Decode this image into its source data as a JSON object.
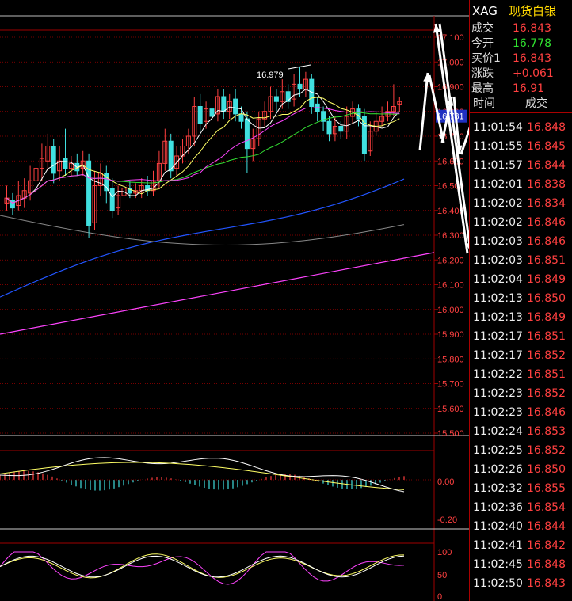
{
  "quote": {
    "symbol": "XAG",
    "name": "现货白银",
    "fields": [
      {
        "label": "成交",
        "value": "16.843",
        "color": "#ff4040"
      },
      {
        "label": "今开",
        "value": "16.778",
        "color": "#30e030"
      },
      {
        "label": "买价1",
        "value": "16.843",
        "color": "#ff4040"
      },
      {
        "label": "涨跌",
        "value": "+0.061",
        "color": "#ff4040"
      },
      {
        "label": "最高",
        "value": "16.91",
        "color": "#ff4040"
      }
    ]
  },
  "trades_header": {
    "time": "时间",
    "price": "成交"
  },
  "trades": [
    {
      "time": "11:01:54",
      "price": "16.848"
    },
    {
      "time": "11:01:55",
      "price": "16.845"
    },
    {
      "time": "11:01:57",
      "price": "16.844"
    },
    {
      "time": "11:02:01",
      "price": "16.838"
    },
    {
      "time": "11:02:02",
      "price": "16.834"
    },
    {
      "time": "11:02:02",
      "price": "16.846"
    },
    {
      "time": "11:02:03",
      "price": "16.846"
    },
    {
      "time": "11:02:03",
      "price": "16.851"
    },
    {
      "time": "11:02:04",
      "price": "16.849"
    },
    {
      "time": "11:02:13",
      "price": "16.850"
    },
    {
      "time": "11:02:13",
      "price": "16.849"
    },
    {
      "time": "11:02:17",
      "price": "16.851"
    },
    {
      "time": "11:02:17",
      "price": "16.852"
    },
    {
      "time": "11:02:22",
      "price": "16.851"
    },
    {
      "time": "11:02:23",
      "price": "16.852"
    },
    {
      "time": "11:02:23",
      "price": "16.846"
    },
    {
      "time": "11:02:24",
      "price": "16.853"
    },
    {
      "time": "11:02:25",
      "price": "16.852"
    },
    {
      "time": "11:02:26",
      "price": "16.850"
    },
    {
      "time": "11:02:32",
      "price": "16.855"
    },
    {
      "time": "11:02:36",
      "price": "16.854"
    },
    {
      "time": "11:02:40",
      "price": "16.844"
    },
    {
      "time": "11:02:41",
      "price": "16.842"
    },
    {
      "time": "11:02:45",
      "price": "16.848"
    },
    {
      "time": "11:02:50",
      "price": "16.843"
    }
  ],
  "price_axis": {
    "ticks": [
      "17.100",
      "17.000",
      "16.900",
      "16.800",
      "16.700",
      "16.600",
      "16.500",
      "16.400",
      "16.300",
      "16.200",
      "16.100",
      "16.000",
      "15.900",
      "15.800",
      "15.700",
      "15.600",
      "15.500"
    ],
    "current_price_tag": "16.781",
    "high_annotation": "16.979"
  },
  "macd_axis": {
    "ticks": [
      "0.00",
      "-0.20"
    ]
  },
  "kdj_axis": {
    "ticks": [
      "100",
      "50",
      "0"
    ]
  },
  "colors": {
    "up": "#ff4040",
    "down": "#40e0e0",
    "grid": "#a00000",
    "ma5": "#ffffff",
    "ma10": "#ffff66",
    "ma20": "#ff44ff",
    "ma30": "#33dd33",
    "ma60": "#2255ff",
    "ma120": "#888888",
    "ma250": "#ff44ff"
  },
  "chart_data": {
    "type": "candlestick",
    "ylim": [
      15.5,
      17.1
    ],
    "candles": [
      {
        "o": 16.43,
        "c": 16.45,
        "h": 16.5,
        "l": 16.4
      },
      {
        "o": 16.44,
        "c": 16.41,
        "h": 16.47,
        "l": 16.38
      },
      {
        "o": 16.42,
        "c": 16.46,
        "h": 16.52,
        "l": 16.4
      },
      {
        "o": 16.45,
        "c": 16.48,
        "h": 16.53,
        "l": 16.41
      },
      {
        "o": 16.47,
        "c": 16.52,
        "h": 16.58,
        "l": 16.44
      },
      {
        "o": 16.52,
        "c": 16.57,
        "h": 16.62,
        "l": 16.49
      },
      {
        "o": 16.57,
        "c": 16.61,
        "h": 16.67,
        "l": 16.52
      },
      {
        "o": 16.6,
        "c": 16.66,
        "h": 16.71,
        "l": 16.56
      },
      {
        "o": 16.66,
        "c": 16.55,
        "h": 16.69,
        "l": 16.51
      },
      {
        "o": 16.56,
        "c": 16.6,
        "h": 16.66,
        "l": 16.52
      },
      {
        "o": 16.61,
        "c": 16.57,
        "h": 16.73,
        "l": 16.54
      },
      {
        "o": 16.57,
        "c": 16.59,
        "h": 16.62,
        "l": 16.54
      },
      {
        "o": 16.59,
        "c": 16.56,
        "h": 16.63,
        "l": 16.54
      },
      {
        "o": 16.57,
        "c": 16.6,
        "h": 16.64,
        "l": 16.54
      },
      {
        "o": 16.6,
        "c": 16.34,
        "h": 16.63,
        "l": 16.29
      },
      {
        "o": 16.35,
        "c": 16.5,
        "h": 16.56,
        "l": 16.32
      },
      {
        "o": 16.5,
        "c": 16.55,
        "h": 16.59,
        "l": 16.46
      },
      {
        "o": 16.55,
        "c": 16.48,
        "h": 16.58,
        "l": 16.43
      },
      {
        "o": 16.49,
        "c": 16.4,
        "h": 16.53,
        "l": 16.37
      },
      {
        "o": 16.41,
        "c": 16.46,
        "h": 16.5,
        "l": 16.38
      },
      {
        "o": 16.46,
        "c": 16.49,
        "h": 16.53,
        "l": 16.43
      },
      {
        "o": 16.49,
        "c": 16.47,
        "h": 16.52,
        "l": 16.45
      },
      {
        "o": 16.47,
        "c": 16.48,
        "h": 16.51,
        "l": 16.45
      },
      {
        "o": 16.48,
        "c": 16.5,
        "h": 16.53,
        "l": 16.45
      },
      {
        "o": 16.5,
        "c": 16.48,
        "h": 16.54,
        "l": 16.46
      },
      {
        "o": 16.48,
        "c": 16.52,
        "h": 16.56,
        "l": 16.46
      },
      {
        "o": 16.52,
        "c": 16.59,
        "h": 16.64,
        "l": 16.49
      },
      {
        "o": 16.59,
        "c": 16.68,
        "h": 16.73,
        "l": 16.56
      },
      {
        "o": 16.68,
        "c": 16.56,
        "h": 16.71,
        "l": 16.53
      },
      {
        "o": 16.57,
        "c": 16.62,
        "h": 16.66,
        "l": 16.54
      },
      {
        "o": 16.62,
        "c": 16.66,
        "h": 16.69,
        "l": 16.59
      },
      {
        "o": 16.66,
        "c": 16.7,
        "h": 16.73,
        "l": 16.63
      },
      {
        "o": 16.7,
        "c": 16.82,
        "h": 16.86,
        "l": 16.66
      },
      {
        "o": 16.82,
        "c": 16.75,
        "h": 16.87,
        "l": 16.72
      },
      {
        "o": 16.76,
        "c": 16.81,
        "h": 16.84,
        "l": 16.73
      },
      {
        "o": 16.81,
        "c": 16.78,
        "h": 16.84,
        "l": 16.75
      },
      {
        "o": 16.79,
        "c": 16.86,
        "h": 16.89,
        "l": 16.76
      },
      {
        "o": 16.86,
        "c": 16.8,
        "h": 16.89,
        "l": 16.77
      },
      {
        "o": 16.8,
        "c": 16.84,
        "h": 16.87,
        "l": 16.77
      },
      {
        "o": 16.85,
        "c": 16.79,
        "h": 16.89,
        "l": 16.76
      },
      {
        "o": 16.79,
        "c": 16.76,
        "h": 16.82,
        "l": 16.73
      },
      {
        "o": 16.77,
        "c": 16.65,
        "h": 16.8,
        "l": 16.55
      },
      {
        "o": 16.65,
        "c": 16.69,
        "h": 16.73,
        "l": 16.6
      },
      {
        "o": 16.69,
        "c": 16.77,
        "h": 16.8,
        "l": 16.66
      },
      {
        "o": 16.77,
        "c": 16.8,
        "h": 16.84,
        "l": 16.74
      },
      {
        "o": 16.8,
        "c": 16.86,
        "h": 16.9,
        "l": 16.77
      },
      {
        "o": 16.86,
        "c": 16.84,
        "h": 16.89,
        "l": 16.8
      },
      {
        "o": 16.84,
        "c": 16.88,
        "h": 16.93,
        "l": 16.81
      },
      {
        "o": 16.88,
        "c": 16.84,
        "h": 16.91,
        "l": 16.81
      },
      {
        "o": 16.85,
        "c": 16.91,
        "h": 16.95,
        "l": 16.82
      },
      {
        "o": 16.91,
        "c": 16.89,
        "h": 16.98,
        "l": 16.86
      },
      {
        "o": 16.89,
        "c": 16.93,
        "h": 16.96,
        "l": 16.86
      },
      {
        "o": 16.93,
        "c": 16.82,
        "h": 16.95,
        "l": 16.79
      },
      {
        "o": 16.83,
        "c": 16.8,
        "h": 16.86,
        "l": 16.76
      },
      {
        "o": 16.8,
        "c": 16.76,
        "h": 16.82,
        "l": 16.72
      },
      {
        "o": 16.76,
        "c": 16.71,
        "h": 16.78,
        "l": 16.68
      },
      {
        "o": 16.71,
        "c": 16.74,
        "h": 16.78,
        "l": 16.68
      },
      {
        "o": 16.74,
        "c": 16.72,
        "h": 16.76,
        "l": 16.69
      },
      {
        "o": 16.72,
        "c": 16.78,
        "h": 16.82,
        "l": 16.69
      },
      {
        "o": 16.78,
        "c": 16.81,
        "h": 16.84,
        "l": 16.75
      },
      {
        "o": 16.81,
        "c": 16.77,
        "h": 16.83,
        "l": 16.74
      },
      {
        "o": 16.78,
        "c": 16.63,
        "h": 16.81,
        "l": 16.6
      },
      {
        "o": 16.64,
        "c": 16.72,
        "h": 16.76,
        "l": 16.62
      },
      {
        "o": 16.72,
        "c": 16.76,
        "h": 16.8,
        "l": 16.7
      },
      {
        "o": 16.76,
        "c": 16.78,
        "h": 16.82,
        "l": 16.74
      },
      {
        "o": 16.78,
        "c": 16.8,
        "h": 16.84,
        "l": 16.76
      },
      {
        "o": 16.8,
        "c": 16.82,
        "h": 16.91,
        "l": 16.78
      },
      {
        "o": 16.83,
        "c": 16.84,
        "h": 16.86,
        "l": 16.8
      }
    ]
  }
}
